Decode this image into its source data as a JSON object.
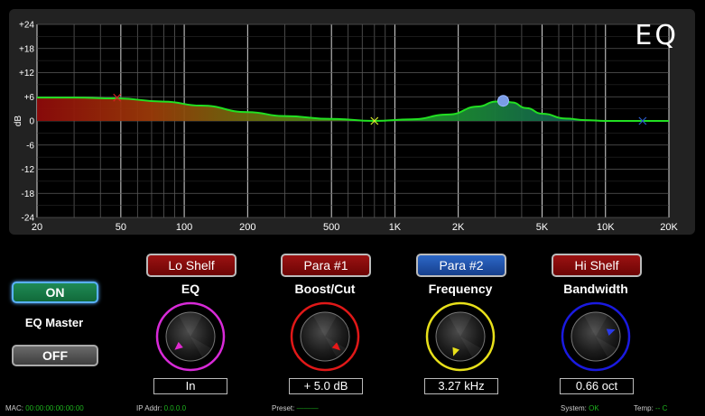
{
  "title": "EQ",
  "graph": {
    "y_ticks": [
      "+24",
      "+18",
      "+12",
      "+6",
      "0",
      "-6",
      "-12",
      "-18",
      "-24"
    ],
    "y_values": [
      24,
      18,
      12,
      6,
      0,
      -6,
      -12,
      -18,
      -24
    ],
    "y_axis_label": "dB",
    "x_ticks": [
      {
        "label": "20",
        "freq": 20
      },
      {
        "label": "50",
        "freq": 50
      },
      {
        "label": "100",
        "freq": 100
      },
      {
        "label": "200",
        "freq": 200
      },
      {
        "label": "500",
        "freq": 500
      },
      {
        "label": "1K",
        "freq": 1000
      },
      {
        "label": "2K",
        "freq": 2000
      },
      {
        "label": "5K",
        "freq": 5000
      },
      {
        "label": "10K",
        "freq": 10000
      },
      {
        "label": "20K",
        "freq": 20000
      }
    ]
  },
  "chart_data": {
    "type": "line",
    "x_scale": "log",
    "xlim": [
      20,
      20000
    ],
    "ylim": [
      -24,
      24
    ],
    "ylabel": "dB",
    "grid": true,
    "series": [
      {
        "x": [
          20,
          30,
          48,
          80,
          120,
          200,
          300,
          500,
          800,
          1200,
          1800,
          2500,
          3000,
          3270,
          3600,
          4200,
          5000,
          6500,
          8000,
          10000,
          14000,
          20000
        ],
        "values": [
          5.8,
          5.8,
          5.6,
          4.8,
          3.8,
          2.2,
          1.2,
          0.5,
          0.0,
          0.4,
          1.6,
          3.6,
          4.8,
          5.0,
          4.6,
          3.2,
          1.8,
          0.6,
          0.2,
          0.0,
          0.0,
          0.0
        ]
      }
    ],
    "points": [
      {
        "freq": 48,
        "gain": 5.8,
        "marker": "x",
        "color": "#d22020"
      },
      {
        "freq": 800,
        "gain": 0.0,
        "marker": "x",
        "color": "#d8f02a"
      },
      {
        "freq": 3270,
        "gain": 5.0,
        "marker": "circle",
        "color": "#7a9ce6"
      },
      {
        "freq": 15000,
        "gain": 0.0,
        "marker": "x",
        "color": "#2a5acc"
      }
    ]
  },
  "bands": [
    {
      "label": "Lo Shelf",
      "color": "red"
    },
    {
      "label": "Para #1",
      "color": "red"
    },
    {
      "label": "Para #2",
      "color": "blue"
    },
    {
      "label": "Hi Shelf",
      "color": "red"
    }
  ],
  "controls": [
    {
      "label": "EQ",
      "value": "In",
      "ring": "#d82ad8",
      "pointer": "#e02ad0"
    },
    {
      "label": "Boost/Cut",
      "value": "+ 5.0 dB",
      "ring": "#e01818",
      "pointer": "#e81818"
    },
    {
      "label": "Frequency",
      "value": "3.27 kHz",
      "ring": "#e8e01a",
      "pointer": "#e8e01a"
    },
    {
      "label": "Bandwidth",
      "value": "0.66 oct",
      "ring": "#1a1ae0",
      "pointer": "#2a3ae8"
    }
  ],
  "master": {
    "on_label": "ON",
    "label": "EQ Master",
    "off_label": "OFF"
  },
  "status": {
    "mac_label": "MAC:",
    "mac_value": "00:00:00:00:00:00",
    "ip_label": "IP Addr:",
    "ip_value": "0.0.0.0",
    "preset_label": "Preset:",
    "preset_value": "———",
    "system_label": "System:",
    "system_value": "OK",
    "temp_label": "Temp:",
    "temp_value": "-- C"
  },
  "colors": {
    "accent_green": "#1db21d",
    "curve_green": "#22e022",
    "band_red": "#8a0b0b",
    "band_blue": "#2456b0"
  }
}
